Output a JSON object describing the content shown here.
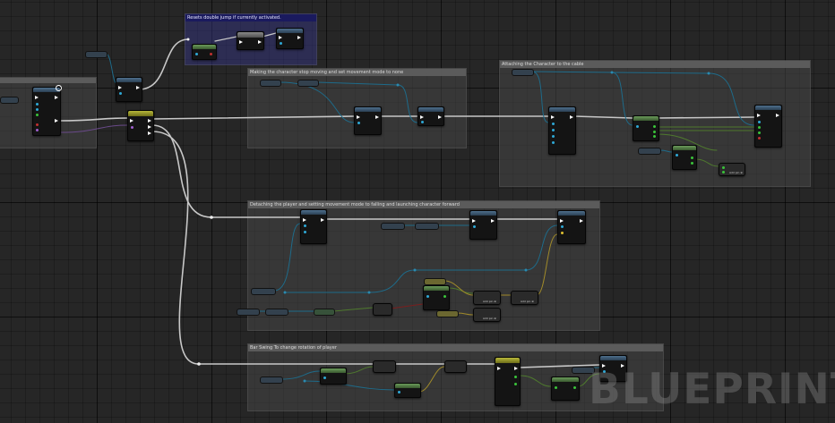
{
  "comments": [
    {
      "id": "reset-jump",
      "title": "Resets double jump if currently activated.",
      "color": "blue"
    },
    {
      "id": "stop-moving",
      "title": "Making the character stop moving and set movement mode to none",
      "color": "gray"
    },
    {
      "id": "attach-cable",
      "title": "Attaching the Character to the cable",
      "color": "gray"
    },
    {
      "id": "detach",
      "title": "Detaching the player and setting movement mode to falling and launching character forward",
      "color": "gray"
    },
    {
      "id": "bar-swing",
      "title": "Bar Swing To change rotation of player",
      "color": "gray"
    }
  ],
  "node_labels": {
    "add_pin": "Add pin ⊕"
  },
  "watermark": "BLUEPRINT",
  "colors": {
    "exec_wire": "#c8c8c8",
    "object_wire": "#1e6b8a",
    "float_wire": "#4f7a2e",
    "vector_wire": "#a08a2a",
    "struct_wire": "#6a4a8a"
  }
}
